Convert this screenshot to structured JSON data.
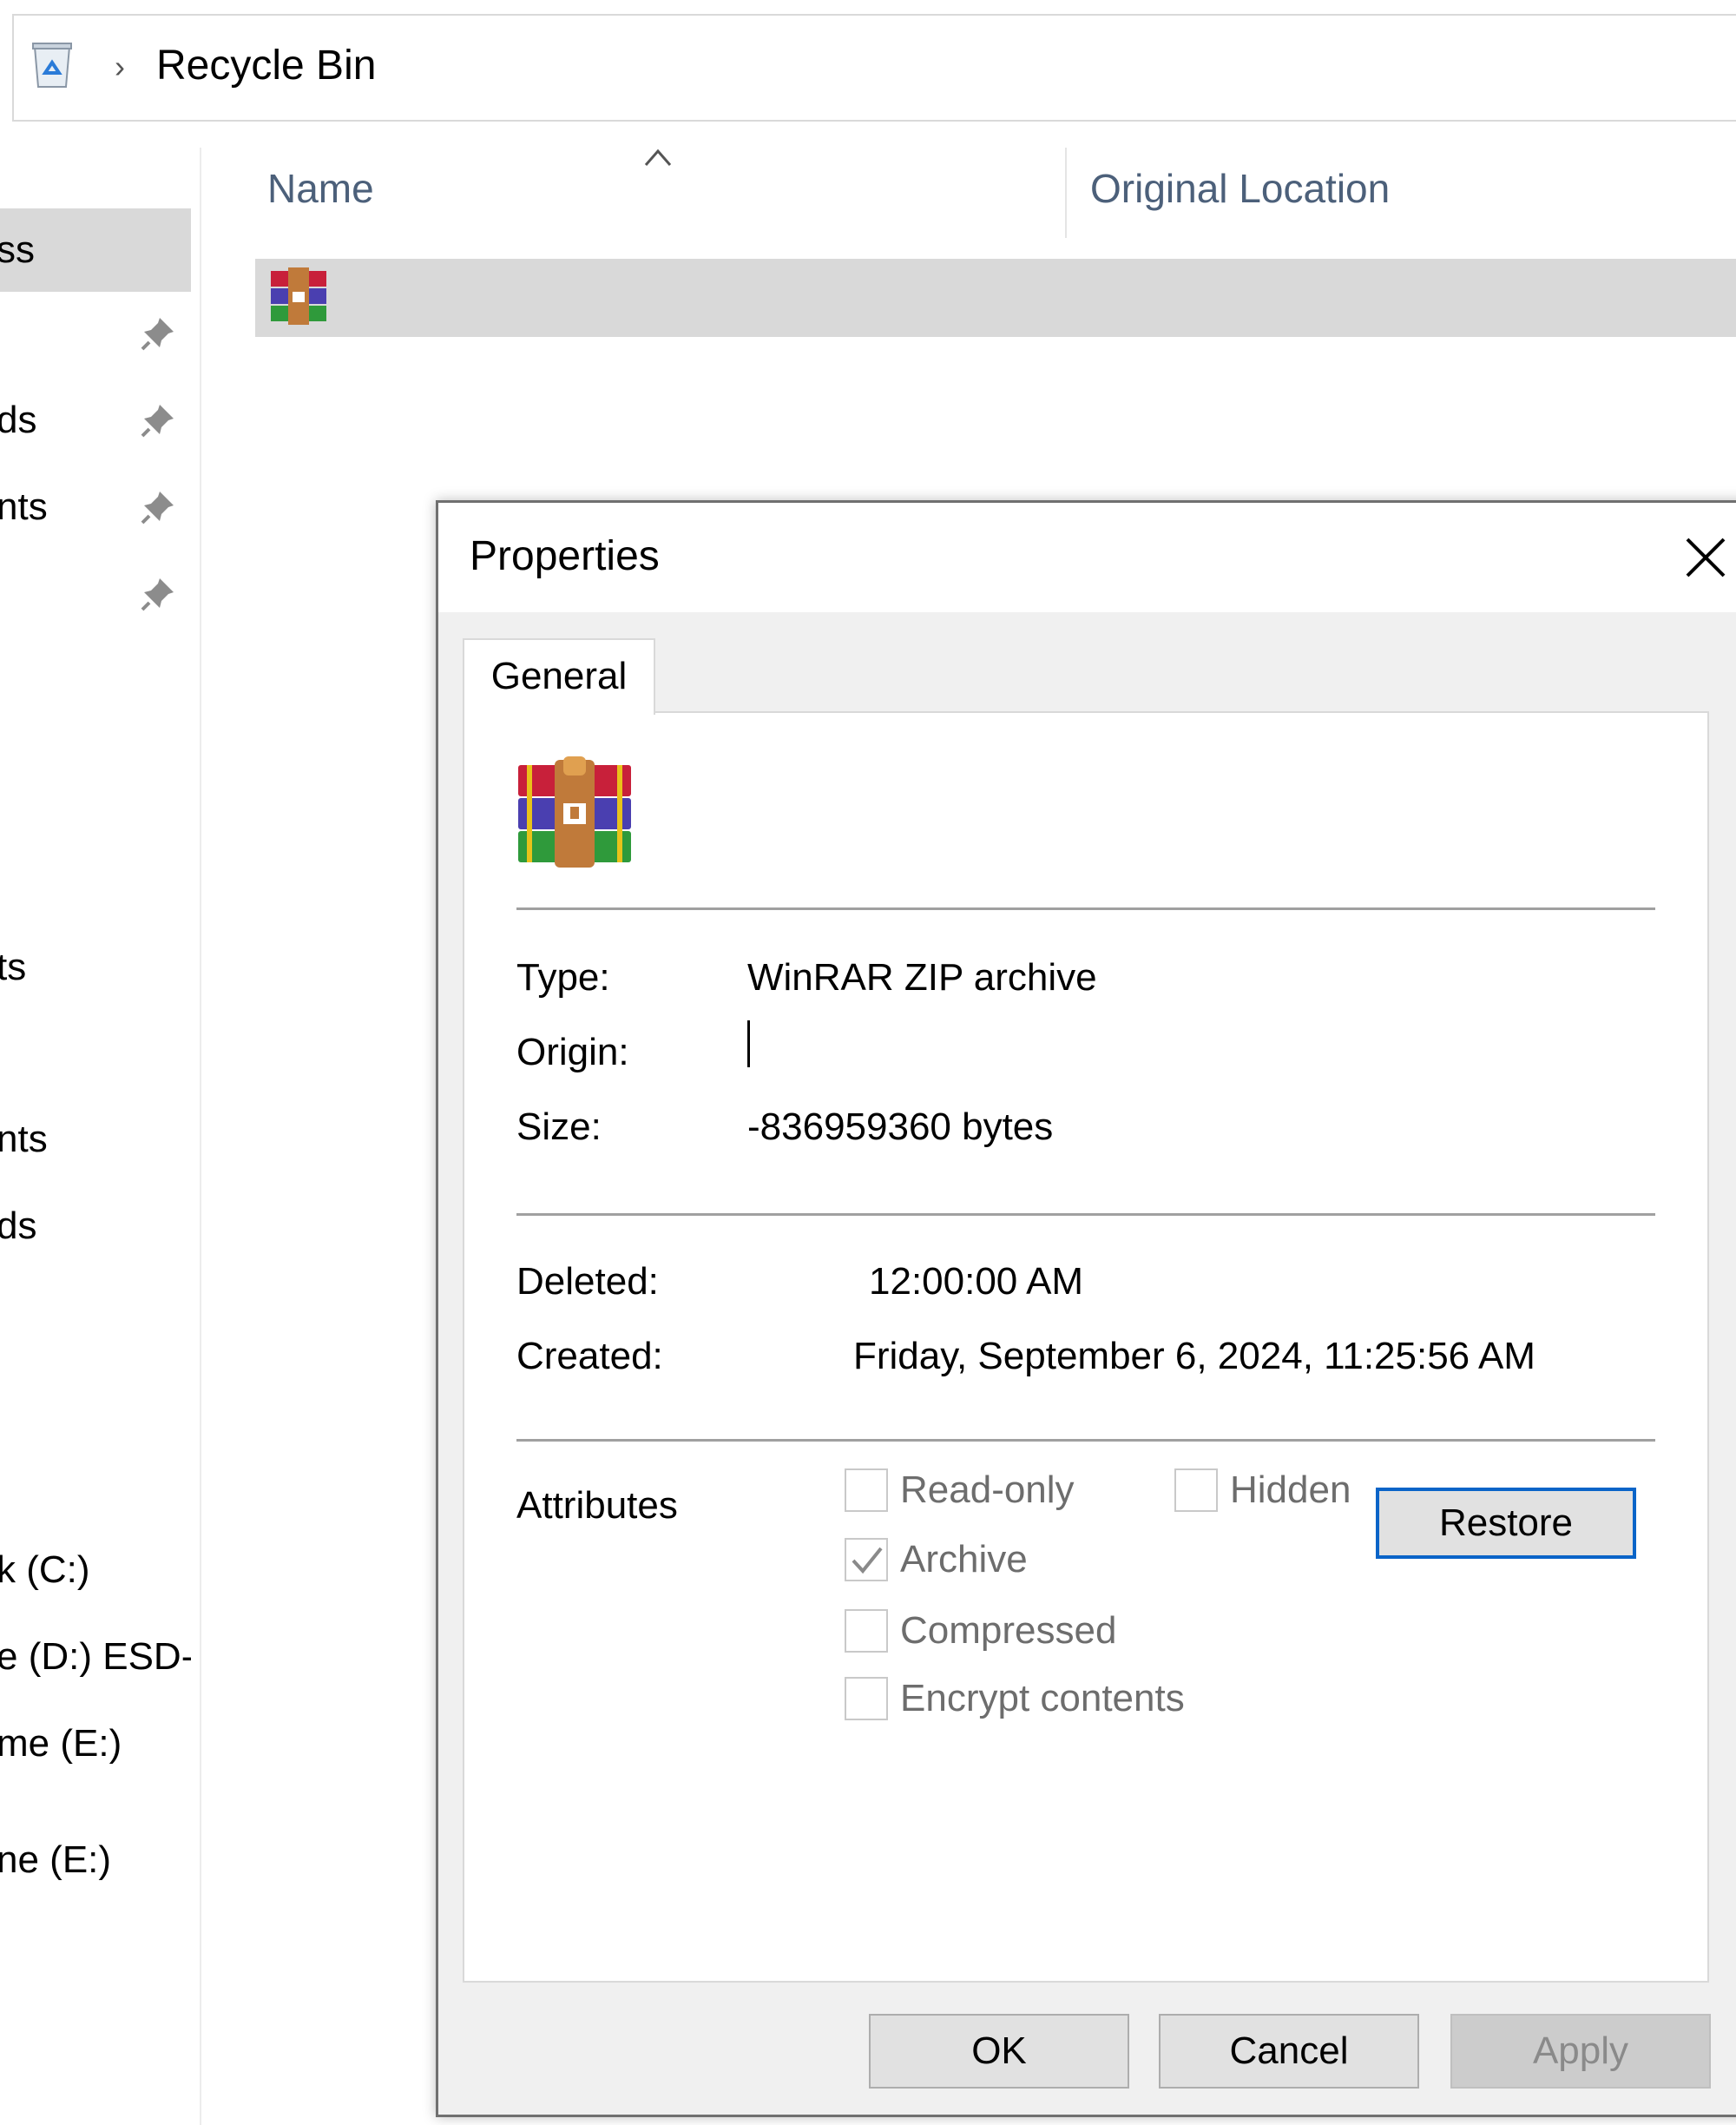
{
  "explorer": {
    "breadcrumb": "Recycle Bin",
    "nav_items": [
      {
        "label": "ss",
        "selected": true,
        "pinned": false
      },
      {
        "label": "",
        "pinned": true
      },
      {
        "label": "ds",
        "pinned": true
      },
      {
        "label": "nts",
        "pinned": true
      },
      {
        "label": "",
        "pinned": true
      },
      {
        "label": "ts"
      },
      {
        "label": "nts"
      },
      {
        "label": "ds"
      },
      {
        "label": "k (C:)"
      },
      {
        "label": "e (D:) ESD-"
      },
      {
        "label": "me (E:)"
      },
      {
        "label": "ne (E:)"
      }
    ],
    "columns": {
      "name": "Name",
      "original_location": "Original Location"
    }
  },
  "dialog": {
    "title": "Properties",
    "tab": "General",
    "type_label": "Type:",
    "type_value": "WinRAR ZIP archive",
    "origin_label": "Origin:",
    "origin_value": "",
    "size_label": "Size:",
    "size_value": "-836959360 bytes",
    "deleted_label": "Deleted:",
    "deleted_value": "12:00:00 AM",
    "created_label": "Created:",
    "created_value": "Friday, September 6, 2024, 11:25:56 AM",
    "attributes_label": "Attributes",
    "attributes": {
      "read_only": {
        "label": "Read-only",
        "checked": false
      },
      "hidden": {
        "label": "Hidden",
        "checked": false
      },
      "archive": {
        "label": "Archive",
        "checked": true
      },
      "compressed": {
        "label": "Compressed",
        "checked": false
      },
      "encrypt": {
        "label": "Encrypt contents",
        "checked": false
      }
    },
    "restore_label": "Restore",
    "ok_label": "OK",
    "cancel_label": "Cancel",
    "apply_label": "Apply"
  },
  "icons": {
    "recycle": "recycle-bin-icon",
    "archive": "winrar-archive-icon",
    "pin": "pin-icon",
    "close": "close-icon",
    "sort": "sort-ascending-icon"
  },
  "colors": {
    "selection": "#d9d9d9",
    "focus_border": "#0a64c8",
    "header_text": "#4c607a"
  }
}
